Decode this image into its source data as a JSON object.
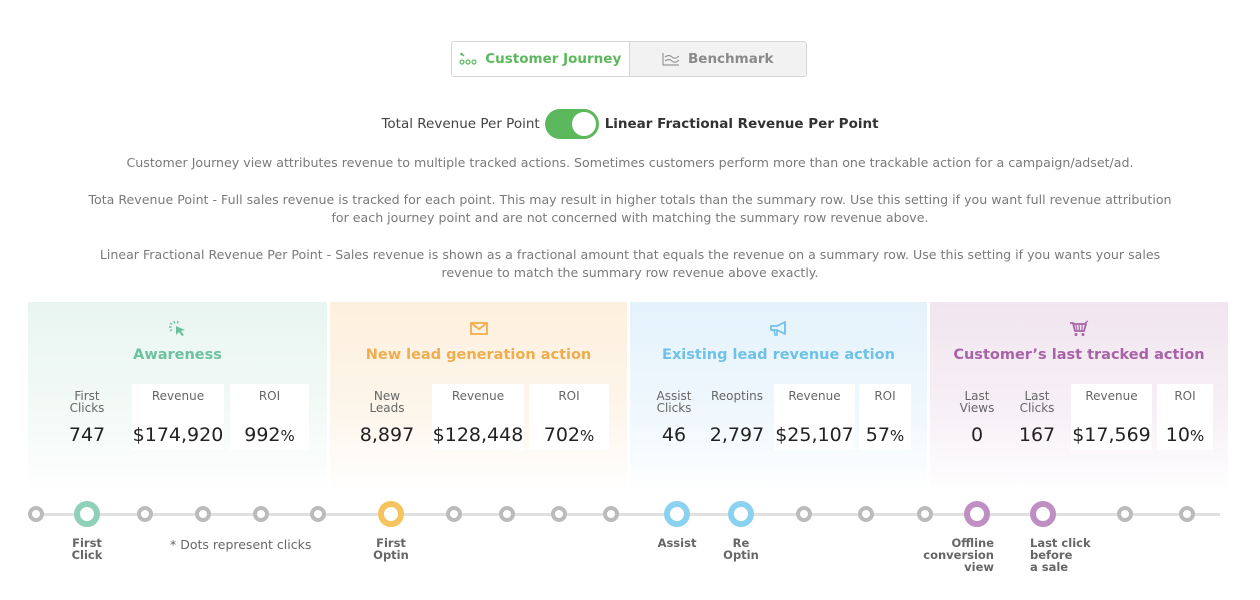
{
  "tabs": [
    {
      "label": "Customer Journey",
      "icon": "journey-dots-icon",
      "active": true
    },
    {
      "label": "Benchmark",
      "icon": "benchmark-chart-icon",
      "active": false
    }
  ],
  "toggle": {
    "left_label": "Total Revenue Per Point",
    "right_label": "Linear Fractional Revenue Per Point",
    "state": "right",
    "color": "#5cb85c"
  },
  "descriptions": [
    "Customer Journey view attributes revenue to multiple tracked actions. Sometimes customers perform more than one trackable action for a campaign/adset/ad.",
    "Tota Revenue Point - Full sales revenue is tracked for each point. This may result in higher totals than the summary row. Use this setting if you want full revenue attribution for each journey point and are not concerned with matching the summary row revenue above.",
    "Linear Fractional Revenue Per Point - Sales revenue is shown as a fractional amount that equals the revenue on a summary row. Use this setting if you wants your sales revenue to match the summary row revenue above exactly."
  ],
  "panels": [
    {
      "title": "Awareness",
      "icon": "cursor-click-icon",
      "color": "#6cc19e",
      "metrics": [
        {
          "label": "First Clicks",
          "value": "747"
        },
        {
          "label": "Revenue",
          "value": "$174,920"
        },
        {
          "label": "ROI",
          "value": "992",
          "suffix": "%"
        }
      ]
    },
    {
      "title": "New lead generation action",
      "icon": "envelope-icon",
      "color": "#f0ad4e",
      "metrics": [
        {
          "label": "New Leads",
          "value": "8,897"
        },
        {
          "label": "Revenue",
          "value": "$128,448"
        },
        {
          "label": "ROI",
          "value": "702",
          "suffix": "%"
        }
      ]
    },
    {
      "title": "Existing lead revenue action",
      "icon": "megaphone-icon",
      "color": "#6ec1e8",
      "metrics": [
        {
          "label": "Assist Clicks",
          "value": "46"
        },
        {
          "label": "Reoptins",
          "value": "2,797"
        },
        {
          "label": "Revenue",
          "value": "$25,107"
        },
        {
          "label": "ROI",
          "value": "57",
          "suffix": "%"
        }
      ]
    },
    {
      "title": "Customer’s last tracked action",
      "icon": "shopping-cart-icon",
      "color": "#a862a8",
      "metrics": [
        {
          "label": "Last Views",
          "value": "0"
        },
        {
          "label": "Last Clicks",
          "value": "167"
        },
        {
          "label": "Revenue",
          "value": "$17,569"
        },
        {
          "label": "ROI",
          "value": "10",
          "suffix": "%"
        }
      ]
    }
  ],
  "timeline": {
    "note": "* Dots represent clicks",
    "milestones": [
      {
        "label_lines": [
          "First",
          "Click"
        ],
        "color": "green"
      },
      {
        "label_lines": [
          "First",
          "Optin"
        ],
        "color": "orange"
      },
      {
        "label_lines": [
          "Assist"
        ],
        "color": "blue"
      },
      {
        "label_lines": [
          "Re",
          "Optin"
        ],
        "color": "blue"
      },
      {
        "label_lines": [
          "Offline",
          "conversion",
          "view"
        ],
        "color": "purple"
      },
      {
        "label_lines": [
          "Last click",
          "before",
          "a sale"
        ],
        "color": "purple"
      }
    ]
  }
}
